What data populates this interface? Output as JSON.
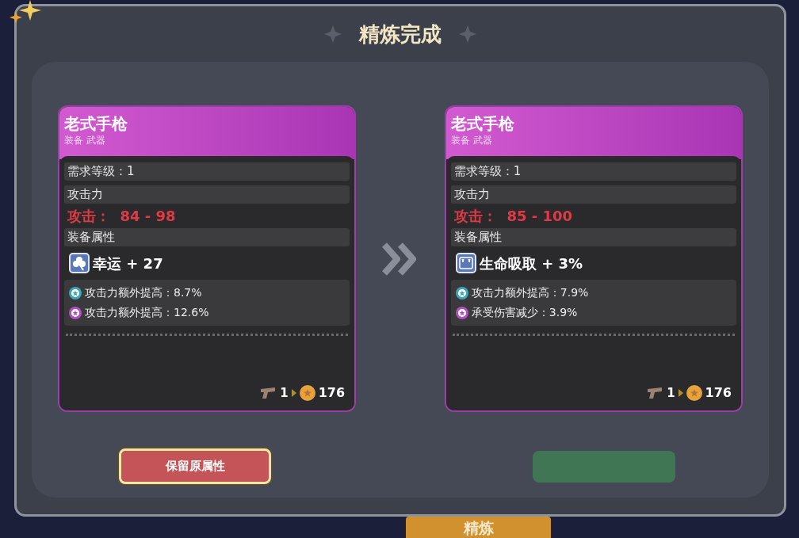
{
  "dialog": {
    "title": "精炼完成",
    "cards": [
      {
        "name": "老式手枪",
        "type": "装备 武器",
        "level_row": "需求等级：1",
        "attack_header": "攻击力",
        "attack": "攻击：  84 - 98",
        "attributes_header": "装备属性",
        "main_attribute": {
          "kind": "luck",
          "text": "幸运 + 27"
        },
        "bonuses": [
          {
            "color": "#3aa6b9",
            "text": "攻击力额外提高：8.7%"
          },
          {
            "color": "#b04fc0",
            "text": "攻击力额外提高：12.6%"
          }
        ],
        "count": "1",
        "price": "176"
      },
      {
        "name": "老式手枪",
        "type": "装备 武器",
        "level_row": "需求等级：1",
        "attack_header": "攻击力",
        "attack": "攻击：  85 - 100",
        "attributes_header": "装备属性",
        "main_attribute": {
          "kind": "lifesteal",
          "text": "生命吸取 + 3%"
        },
        "bonuses": [
          {
            "color": "#3aa6b9",
            "text": "攻击力额外提高：7.9%"
          },
          {
            "color": "#b04fc0",
            "text": "承受伤害减少：3.9%"
          }
        ],
        "count": "1",
        "price": "176"
      }
    ],
    "keep_button": "保留原属性"
  },
  "bottom_tab": "精炼"
}
